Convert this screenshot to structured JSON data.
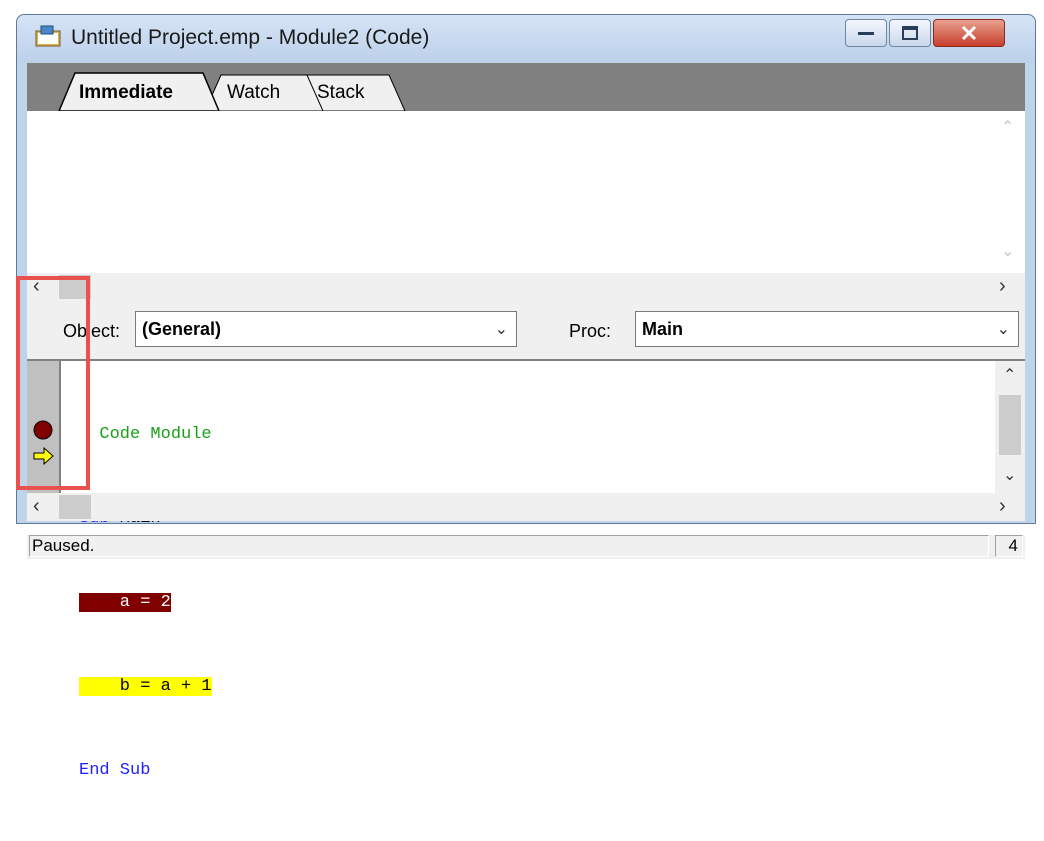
{
  "window": {
    "title": "Untitled Project.emp - Module2 (Code)"
  },
  "tabs": [
    {
      "label": "Immediate",
      "active": true
    },
    {
      "label": "Watch",
      "active": false
    },
    {
      "label": "Stack",
      "active": false
    }
  ],
  "combos": {
    "object_label": "Object:",
    "object_value": "(General)",
    "proc_label": "Proc:",
    "proc_value": "Main"
  },
  "code": {
    "lines": [
      {
        "text": "  Code Module",
        "style": "comment"
      },
      {
        "text": "Sub Main",
        "style": "kw-prefix",
        "kw": "Sub",
        "rest": " Main"
      },
      {
        "text": "    a = 2",
        "style": "breakpoint"
      },
      {
        "text": "    b = a + 1",
        "style": "current"
      },
      {
        "text": "End Sub",
        "style": "kw"
      }
    ]
  },
  "status": {
    "text": "Paused.",
    "count": "4"
  },
  "colors": {
    "breakpoint": "#800000",
    "current_line": "#ffff00",
    "keyword": "#2020ff",
    "comment": "#18a018",
    "annotation_box": "#e8514e"
  },
  "icons": {
    "breakpoint": "breakpoint-dot-icon",
    "current": "arrow-right-icon"
  }
}
